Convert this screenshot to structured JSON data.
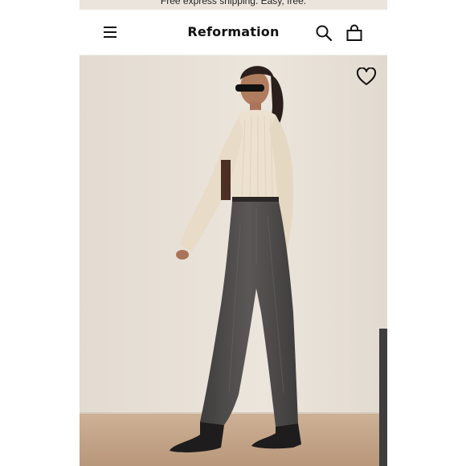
{
  "promo": {
    "text": "Free express shipping. Easy, free."
  },
  "header": {
    "brand": "Reformation"
  },
  "icons": {
    "menu": "hamburger-menu-icon",
    "search": "search-icon",
    "bag": "shopping-bag-icon",
    "wishlist": "heart-icon"
  },
  "product_image": {
    "alt": "Model wearing cream knit sweater and washed black straight jeans"
  },
  "colors": {
    "promo_bar": "#ebe4dc",
    "wall": "#e7e0d7",
    "floor": "#c7a98c",
    "sweater": "#ece1cf",
    "jeans": "#4a4848",
    "text": "#111111"
  }
}
